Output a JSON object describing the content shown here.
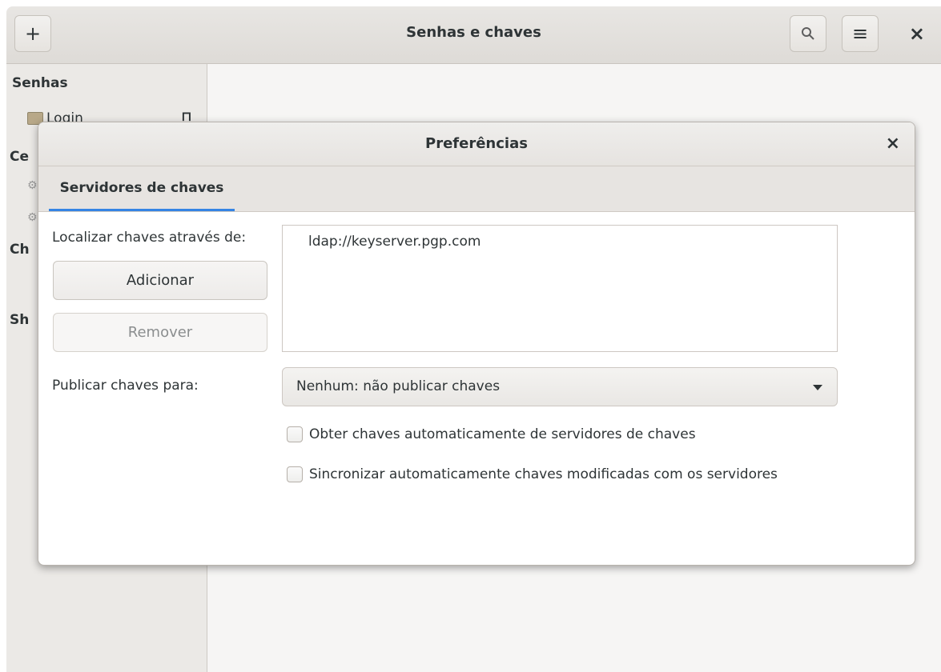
{
  "window": {
    "title": "Senhas e chaves",
    "add_label": "+",
    "menu_label": "≡",
    "close_label": "×"
  },
  "sidebar": {
    "sections": [
      {
        "label": "Senhas"
      },
      {
        "label": "Ce"
      },
      {
        "label": "Ch"
      },
      {
        "label": "Sh"
      }
    ],
    "items": [
      {
        "label": "Login",
        "status_glyph": "⊓"
      }
    ]
  },
  "dialog": {
    "title": "Preferências",
    "close_label": "×",
    "tabs": [
      {
        "label": "Servidores de chaves",
        "active": true
      }
    ],
    "find_label": "Localizar chaves através de:",
    "add_button": "Adicionar",
    "remove_button": "Remover",
    "remove_disabled": true,
    "keyservers": [
      "ldap://keyserver.pgp.com"
    ],
    "publish_label": "Publicar chaves para:",
    "publish_select": "Nenhum: não publicar chaves",
    "checkboxes": [
      {
        "label": "Obter chaves automaticamente de servidores de chaves",
        "checked": false
      },
      {
        "label": "Sincronizar automaticamente chaves modificadas com os servidores",
        "checked": false
      }
    ]
  },
  "colors": {
    "accent": "#3584e4",
    "headerbar": "#e8e6e3",
    "sidebar": "#ebe9e6",
    "dialog_bg": "#ffffff"
  },
  "icons": {
    "search": "search-icon",
    "menu": "hamburger-menu-icon",
    "folder": "folder-icon",
    "dropdown": "chevron-down-icon"
  }
}
